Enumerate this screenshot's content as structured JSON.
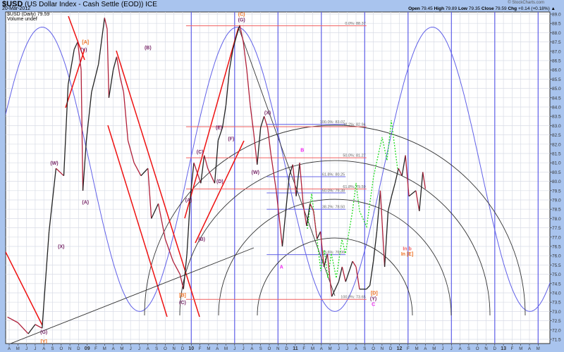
{
  "header": {
    "symbol": "$USD",
    "name": "(US Dollar Index - Cash Settle (EOD)) ICE",
    "date": "20-Mar-2012",
    "copyright": "© StockCharts.com",
    "open_label": "Open",
    "open": "79.45",
    "high_label": "High",
    "high": "79.89",
    "low_label": "Low",
    "low": "79.35",
    "close_label": "Close",
    "close": "79.59",
    "chg_label": "Chg",
    "chg": "+0.14 (+0.18%) ▲"
  },
  "legend": {
    "series": "$USD (Daily) 79.59",
    "volume": "Volume undef"
  },
  "colors": {
    "up": "#222222",
    "down": "#b0203a",
    "grid": "#d8dce6",
    "cycle": "#6060e8",
    "fib_red": "#f06060",
    "fib_blue": "#6a6ae8",
    "green": "#22dd22",
    "purple": "#7a2a6a",
    "orange": "#f07020",
    "magenta": "#ee22ee"
  },
  "chart_data": {
    "type": "line",
    "title": "$USD (US Dollar Index - Cash Settle (EOD)) ICE",
    "xunit": "months since Apr 2008",
    "xlim": [
      -0.3,
      62.5
    ],
    "ylim": [
      71.2,
      89.2
    ],
    "yticks": [
      71.5,
      72.0,
      72.5,
      73.0,
      73.5,
      74.0,
      74.5,
      75.0,
      75.5,
      76.0,
      76.5,
      77.0,
      77.5,
      78.0,
      78.5,
      79.0,
      79.5,
      80.0,
      80.5,
      81.0,
      81.5,
      82.0,
      82.5,
      83.0,
      83.5,
      84.0,
      84.5,
      85.0,
      85.5,
      86.0,
      86.5,
      87.0,
      87.5,
      88.0,
      88.5,
      89.0
    ],
    "ytick_labels": [
      "71.5",
      "72.0",
      "72.5",
      "73.0",
      "73.5",
      "74.0",
      "74.5",
      "75.0",
      "75.5",
      "76.0",
      "76.5",
      "77.0",
      "77.5",
      "78.0",
      "78.5",
      "79.0",
      "79.5",
      "80.0",
      "80.5",
      "81.0",
      "81.5",
      "82.0",
      "82.5",
      "83.0",
      "83.5",
      "84.0",
      "84.5",
      "85.0",
      "85.5",
      "86.0",
      "86.5",
      "87.0",
      "87.5",
      "88.0",
      "88.5",
      "89.0"
    ],
    "xtick_labels": [
      "A",
      "M",
      "J",
      "J",
      "A",
      "S",
      "O",
      "N",
      "D",
      "09",
      "F",
      "M",
      "A",
      "M",
      "J",
      "J",
      "A",
      "S",
      "O",
      "N",
      "D",
      "10",
      "F",
      "M",
      "A",
      "M",
      "J",
      "J",
      "A",
      "S",
      "O",
      "N",
      "D",
      "11",
      "F",
      "M",
      "A",
      "M",
      "J",
      "J",
      "A",
      "S",
      "O",
      "N",
      "D",
      "12",
      "F",
      "M",
      "A",
      "M",
      "J",
      "J",
      "A",
      "S",
      "O",
      "N",
      "D",
      "13",
      "F",
      "M",
      "A",
      "M"
    ],
    "series": [
      {
        "name": "$USD",
        "points": [
          [
            -0.2,
            72.7
          ],
          [
            1.0,
            72.4
          ],
          [
            2.2,
            71.8
          ],
          [
            3.0,
            72.3
          ],
          [
            3.8,
            72.1
          ],
          [
            4.6,
            77.3
          ],
          [
            5.4,
            80.7
          ],
          [
            6.3,
            80.3
          ],
          [
            6.8,
            85.2
          ],
          [
            7.5,
            87.1
          ],
          [
            7.9,
            87.5
          ],
          [
            8.3,
            86.0
          ],
          [
            8.5,
            79.5
          ],
          [
            8.9,
            82.2
          ],
          [
            9.5,
            84.8
          ],
          [
            10.3,
            86.3
          ],
          [
            11.0,
            88.8
          ],
          [
            11.3,
            88.2
          ],
          [
            11.5,
            84.5
          ],
          [
            12.0,
            86.0
          ],
          [
            12.4,
            86.7
          ],
          [
            12.8,
            85.6
          ],
          [
            13.2,
            84.8
          ],
          [
            13.7,
            82.2
          ],
          [
            14.4,
            81.0
          ],
          [
            15.2,
            80.3
          ],
          [
            16.0,
            80.7
          ],
          [
            16.4,
            78.0
          ],
          [
            17.2,
            78.8
          ],
          [
            18.0,
            76.9
          ],
          [
            18.9,
            75.7
          ],
          [
            19.7,
            75.0
          ],
          [
            20.1,
            74.2
          ],
          [
            20.5,
            76.1
          ],
          [
            20.9,
            79.2
          ],
          [
            21.3,
            81.0
          ],
          [
            22.1,
            79.9
          ],
          [
            22.5,
            81.4
          ],
          [
            22.9,
            80.7
          ],
          [
            23.7,
            79.9
          ],
          [
            24.1,
            82.2
          ],
          [
            24.6,
            82.9
          ],
          [
            25.0,
            84.1
          ],
          [
            25.4,
            86.0
          ],
          [
            25.8,
            87.1
          ],
          [
            26.2,
            87.8
          ],
          [
            26.6,
            88.4
          ],
          [
            27.0,
            87.5
          ],
          [
            27.4,
            86.0
          ],
          [
            27.8,
            84.1
          ],
          [
            28.2,
            82.6
          ],
          [
            28.6,
            80.9
          ],
          [
            29.0,
            82.9
          ],
          [
            29.4,
            83.5
          ],
          [
            29.8,
            82.9
          ],
          [
            30.2,
            81.4
          ],
          [
            30.8,
            79.5
          ],
          [
            31.5,
            76.5
          ],
          [
            31.9,
            78.4
          ],
          [
            32.3,
            80.3
          ],
          [
            32.7,
            80.9
          ],
          [
            33.1,
            79.2
          ],
          [
            33.5,
            81.0
          ],
          [
            33.9,
            78.8
          ],
          [
            34.3,
            77.6
          ],
          [
            34.7,
            78.8
          ],
          [
            35.1,
            78.4
          ],
          [
            35.5,
            76.9
          ],
          [
            35.9,
            77.3
          ],
          [
            36.3,
            75.4
          ],
          [
            36.7,
            76.1
          ],
          [
            37.2,
            73.8
          ],
          [
            38.0,
            74.6
          ],
          [
            38.4,
            75.4
          ],
          [
            38.8,
            74.6
          ],
          [
            39.6,
            75.7
          ],
          [
            40.0,
            75.4
          ],
          [
            40.4,
            74.2
          ],
          [
            41.2,
            74.2
          ],
          [
            41.6,
            74.4
          ],
          [
            42.0,
            75.7
          ],
          [
            42.4,
            77.3
          ],
          [
            42.8,
            79.5
          ],
          [
            43.3,
            75.4
          ],
          [
            43.7,
            78.4
          ],
          [
            44.1,
            79.2
          ],
          [
            44.5,
            79.9
          ],
          [
            44.9,
            80.7
          ],
          [
            45.3,
            80.3
          ],
          [
            45.7,
            81.4
          ],
          [
            46.1,
            79.2
          ],
          [
            46.9,
            79.5
          ],
          [
            47.3,
            78.4
          ],
          [
            47.7,
            80.5
          ],
          [
            48.0,
            79.6
          ]
        ]
      }
    ],
    "cycle_markers_t": [
      21,
      26,
      31,
      36,
      41,
      46,
      51,
      56,
      61
    ],
    "cycle_wave": {
      "first_peak_t": 3.8,
      "period_months": 22.5,
      "high": 88.3,
      "low": 73.0
    },
    "fibonacci": [
      {
        "label": "0.0%: 88.37",
        "value": 88.37,
        "color": "red",
        "t": [
          20.4,
          41.2
        ]
      },
      {
        "label": "100.0%: 83.07",
        "value": 83.07,
        "color": "blue",
        "t": [
          29.7,
          38.8
        ]
      },
      {
        "label": "38.2%: 82.94",
        "value": 82.94,
        "color": "red",
        "t": [
          20.4,
          41.2
        ]
      },
      {
        "label": "50.0%: 81.27",
        "value": 81.27,
        "color": "red",
        "t": [
          20.4,
          41.2
        ]
      },
      {
        "label": "61.8%: 80.25",
        "value": 80.25,
        "color": "blue",
        "t": [
          29.7,
          38.8
        ]
      },
      {
        "label": "61.8%: 79.59",
        "value": 79.59,
        "color": "red",
        "t": [
          20.4,
          41.2
        ]
      },
      {
        "label": "50.0%: 79.38",
        "value": 79.38,
        "color": "blue",
        "t": [
          29.7,
          38.8
        ]
      },
      {
        "label": "38.2%: 78.50",
        "value": 78.5,
        "color": "blue",
        "t": [
          29.7,
          38.8
        ]
      },
      {
        "label": "23.6%: 76.06",
        "value": 76.06,
        "color": "blue",
        "t": [
          29.7,
          38.8
        ]
      },
      {
        "label": "100.0%: 73.65",
        "value": 73.65,
        "color": "red",
        "t": [
          20.4,
          41.2
        ]
      }
    ],
    "annotations": [
      {
        "text": "[A]",
        "color": "orange",
        "t": 8.8,
        "v": 87.4
      },
      {
        "text": "(Y)",
        "color": "purple",
        "t": 8.6,
        "v": 87.0
      },
      {
        "text": "(B)",
        "color": "purple",
        "t": 16.0,
        "v": 87.1
      },
      {
        "text": "(W)",
        "color": "purple",
        "t": 5.2,
        "v": 80.9
      },
      {
        "text": "(X)",
        "color": "purple",
        "t": 6.0,
        "v": 76.4
      },
      {
        "text": "(A)",
        "color": "purple",
        "t": 8.8,
        "v": 78.8
      },
      {
        "text": "(G)",
        "color": "purple",
        "t": 4.0,
        "v": 71.8
      },
      {
        "text": "[Y]",
        "color": "orange",
        "t": 4.0,
        "v": 71.3
      },
      {
        "text": "(C)",
        "color": "orange",
        "t": 26.8,
        "v": 88.9
      },
      {
        "text": "(G)",
        "color": "purple",
        "t": 26.8,
        "v": 88.6
      },
      {
        "text": "(C)",
        "color": "purple",
        "t": 22.0,
        "v": 81.5
      },
      {
        "text": "(E)",
        "color": "purple",
        "t": 24.2,
        "v": 82.8
      },
      {
        "text": "(F)",
        "color": "purple",
        "t": 25.6,
        "v": 82.2
      },
      {
        "text": "(D)",
        "color": "purple",
        "t": 24.3,
        "v": 79.9
      },
      {
        "text": "(A)",
        "color": "purple",
        "t": 20.7,
        "v": 78.9
      },
      {
        "text": "(B)",
        "color": "purple",
        "t": 22.2,
        "v": 76.8
      },
      {
        "text": "[B]",
        "color": "orange",
        "t": 20.0,
        "v": 73.8
      },
      {
        "text": "(C)",
        "color": "purple",
        "t": 20.0,
        "v": 73.4
      },
      {
        "text": "(X)",
        "color": "purple",
        "t": 29.8,
        "v": 83.6
      },
      {
        "text": "(W)",
        "color": "purple",
        "t": 28.4,
        "v": 80.4
      },
      {
        "text": "B",
        "color": "magenta",
        "t": 33.8,
        "v": 81.6
      },
      {
        "text": "A",
        "color": "magenta",
        "t": 31.4,
        "v": 75.3
      },
      {
        "text": "[D]",
        "color": "orange",
        "t": 42.1,
        "v": 73.9
      },
      {
        "text": "(Y)",
        "color": "purple",
        "t": 42.0,
        "v": 73.6
      },
      {
        "text": "C",
        "color": "magenta",
        "t": 42.0,
        "v": 73.3
      },
      {
        "text": "In b",
        "color": "red",
        "t": 45.9,
        "v": 76.3
      },
      {
        "text": "In [E]",
        "color": "orange",
        "t": 45.9,
        "v": 76.0
      }
    ]
  }
}
